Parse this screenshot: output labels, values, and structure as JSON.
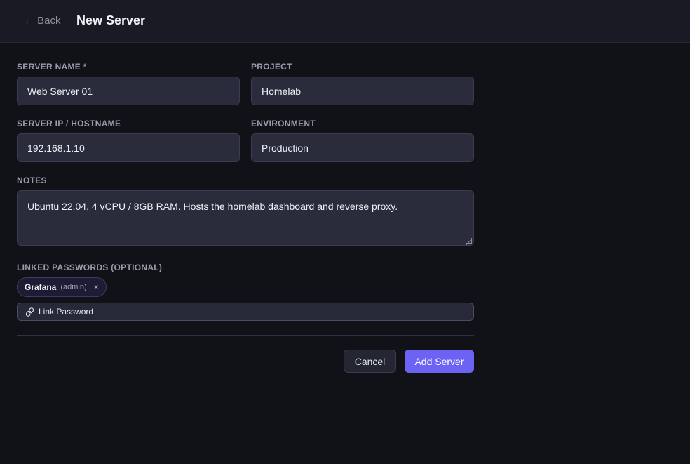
{
  "header": {
    "back_label": "← Back",
    "title": "New Server"
  },
  "form": {
    "server_name": {
      "label": "SERVER NAME *",
      "value": "Web Server 01"
    },
    "project": {
      "label": "PROJECT",
      "value": "Homelab"
    },
    "server_ip": {
      "label": "SERVER IP / HOSTNAME",
      "value": "192.168.1.10"
    },
    "environment": {
      "label": "ENVIRONMENT",
      "value": "Production"
    },
    "notes": {
      "label": "NOTES",
      "value": "Ubuntu 22.04, 4 vCPU / 8GB RAM. Hosts the homelab dashboard and reverse proxy."
    },
    "linked_passwords": {
      "label": "LINKED PASSWORDS (OPTIONAL)",
      "items": [
        {
          "name": "Grafana",
          "role": "(admin)",
          "remove": "×"
        }
      ],
      "link_button_label": "Link Password"
    }
  },
  "actions": {
    "cancel_label": "Cancel",
    "submit_label": "Add Server"
  },
  "colors": {
    "background": "#111218",
    "topbar": "#191a23",
    "input_bg": "#2a2c3b",
    "accent": "#6c63f5"
  },
  "icons": {
    "link_icon": "link-icon",
    "remove_icon": "close-icon"
  }
}
